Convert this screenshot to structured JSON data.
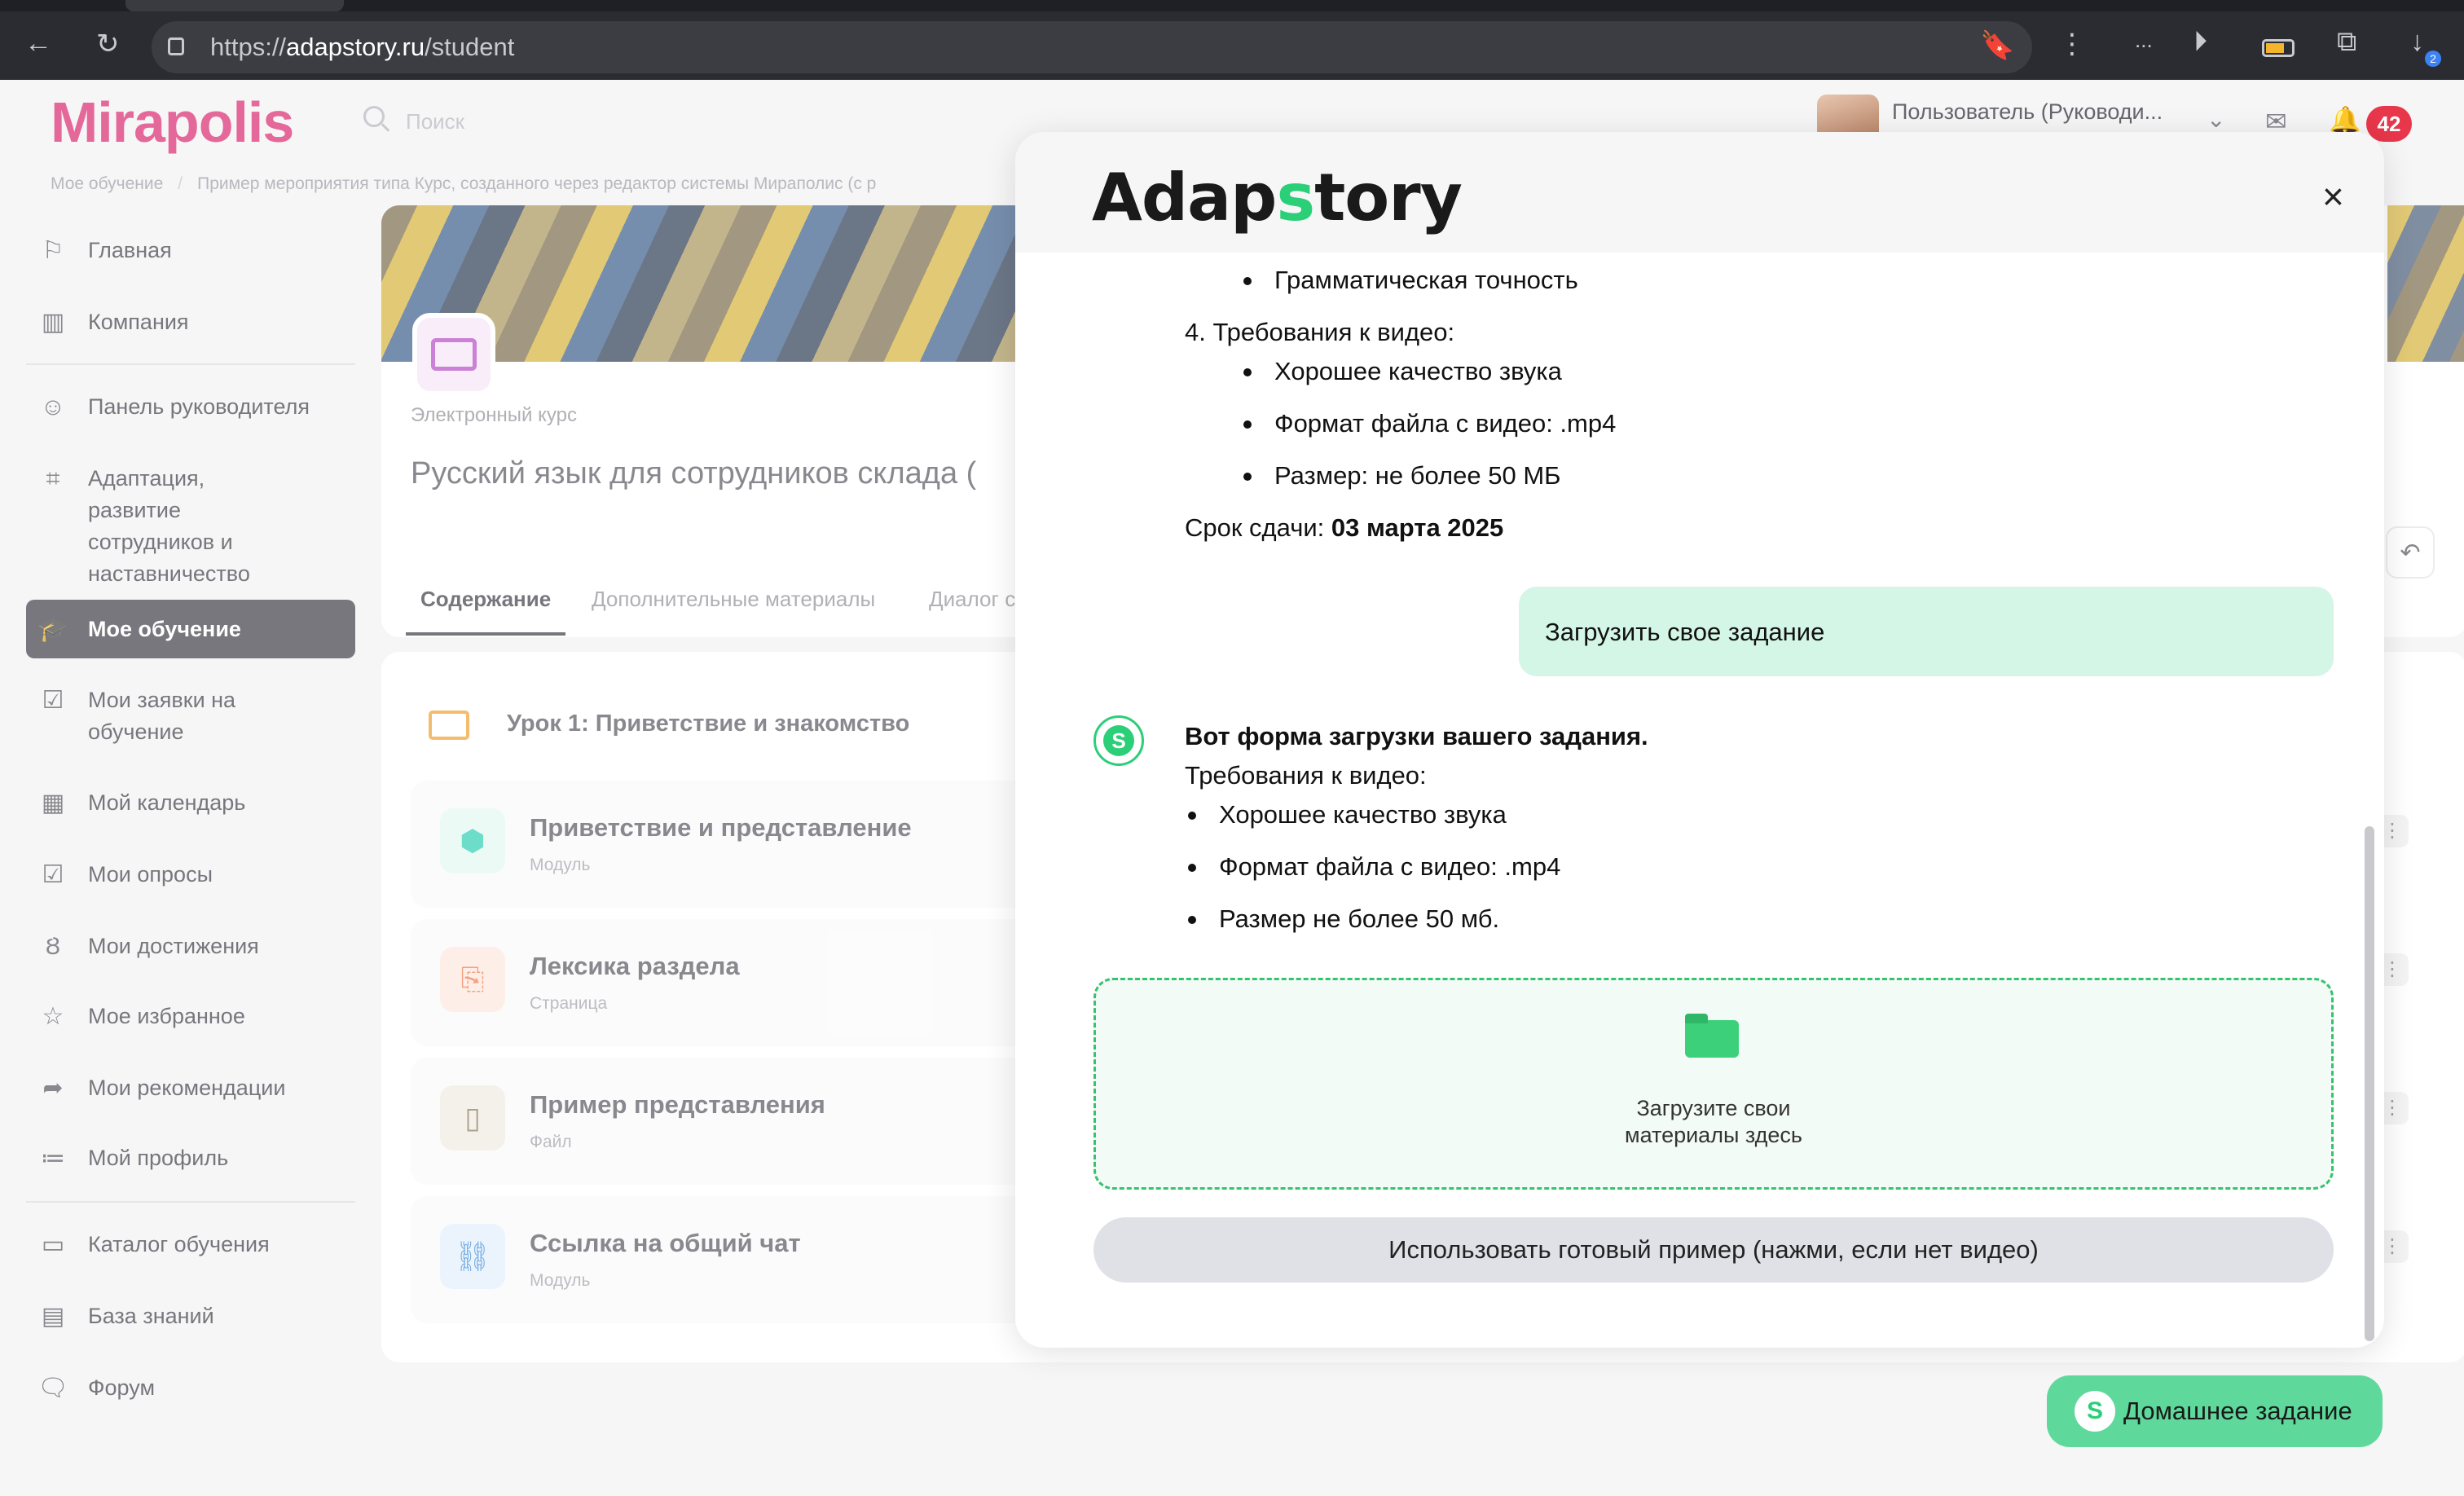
{
  "browser": {
    "url_prefix": "https://",
    "url_host": "adapstory.ru",
    "url_path": "/student",
    "download_badge": "2",
    "more_label": "..."
  },
  "header": {
    "logo": "Mirapolis",
    "search_placeholder": "Поиск",
    "user_name": "Пользователь (Руководи...",
    "notifications_count": "42"
  },
  "breadcrumb": {
    "items": [
      "Мое обучение",
      "Пример мероприятия типа Курс, созданного через редактор системы Мираполис (с р"
    ]
  },
  "sidebar": {
    "items": [
      {
        "label": "Главная",
        "icon": "flag-icon"
      },
      {
        "label": "Компания",
        "icon": "building-icon"
      },
      {
        "label": "Панель руководителя",
        "icon": "manager-icon"
      },
      {
        "label": "Адаптация, развитие сотрудников и наставничество",
        "icon": "chart-icon"
      },
      {
        "label": "Мое обучение",
        "icon": "graduation-cap-icon"
      },
      {
        "label": "Мои заявки на обучение",
        "icon": "document-check-icon"
      },
      {
        "label": "Мой календарь",
        "icon": "calendar-icon"
      },
      {
        "label": "Мои опросы",
        "icon": "checkbox-icon"
      },
      {
        "label": "Мои достижения",
        "icon": "medal-icon"
      },
      {
        "label": "Мое избранное",
        "icon": "star-icon"
      },
      {
        "label": "Мои рекомендации",
        "icon": "share-icon"
      },
      {
        "label": "Мой профиль",
        "icon": "profile-icon"
      },
      {
        "label": "Каталог обучения",
        "icon": "folder-icon"
      },
      {
        "label": "База знаний",
        "icon": "book-icon"
      },
      {
        "label": "Форум",
        "icon": "chat-icon"
      }
    ],
    "active_index": 4
  },
  "course": {
    "type": "Электронный курс",
    "title": "Русский язык для сотрудников склада (",
    "tabs": [
      "Содержание",
      "Дополнительные материалы",
      "Диалог с"
    ],
    "lesson_title": "Урок 1: Приветствие и знакомство",
    "modules": [
      {
        "title": "Приветствие и представление",
        "subtitle": "Модуль",
        "icon": "cubes-icon",
        "color": "#2bcfb0"
      },
      {
        "title": "Лексика раздела",
        "subtitle": "Страница",
        "icon": "page-icon",
        "color": "#f07a4a"
      },
      {
        "title": "Пример представления",
        "subtitle": "Файл",
        "icon": "file-icon",
        "color": "#8a7a5a"
      },
      {
        "title": "Ссылка на общий чат",
        "subtitle": "Модуль",
        "icon": "link-icon",
        "color": "#3a8ad8"
      }
    ]
  },
  "modal": {
    "logo_left": "Adap",
    "logo_s": "s",
    "logo_right": "tory",
    "close": "×",
    "chat": {
      "bullet_grammar": "Грамматическая точность",
      "video_req_heading": "4. Требования к видео:",
      "video_req_items": [
        "Хорошее качество звука",
        "Формат файла с видео: .mp4",
        "Размер: не более 50 МБ"
      ],
      "deadline_label": "Срок сдачи: ",
      "deadline_value": "03 марта 2025",
      "user_message": "Загрузить свое задание",
      "bot_title": "Вот форма загрузки вашего задания.",
      "bot_req_heading": "Требования к видео:",
      "bot_req_items": [
        "Хорошее качество звука",
        "Формат файла с видео: .mp4",
        "Размер не более 50 мб."
      ],
      "dropzone_line1": "Загрузите свои",
      "dropzone_line2": "материалы здесь",
      "sample_button": "Использовать готовый пример (нажми, если нет видео)"
    }
  },
  "homework_button": {
    "label": "Домашнее задание",
    "icon_glyph": "S"
  },
  "colors": {
    "brand_pink": "#d9286f",
    "accent_green": "#2bcf78",
    "bubble_green": "#d4f6e6",
    "notif_red": "#e8364a"
  }
}
